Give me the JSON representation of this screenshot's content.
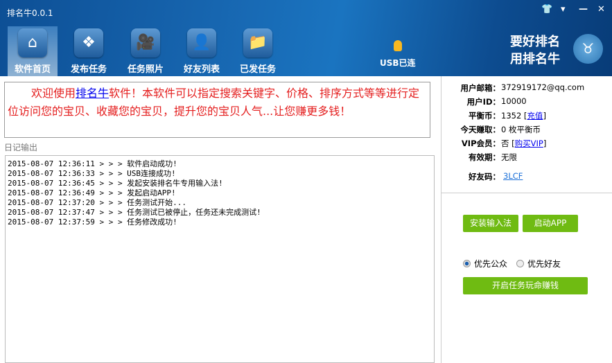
{
  "window": {
    "title": "排名牛0.0.1",
    "controls": [
      {
        "name": "skin",
        "glyph": "👕"
      },
      {
        "name": "menu",
        "glyph": "▾"
      },
      {
        "name": "minimize",
        "glyph": "—"
      },
      {
        "name": "close",
        "glyph": "✕"
      }
    ]
  },
  "nav": [
    {
      "label": "软件首页",
      "icon": "home-icon",
      "glyph": "⌂",
      "active": true
    },
    {
      "label": "发布任务",
      "icon": "diamond-grid-icon",
      "glyph": "❖"
    },
    {
      "label": "任务照片",
      "icon": "video-camera-icon",
      "glyph": "🎥"
    },
    {
      "label": "好友列表",
      "icon": "person-icon",
      "glyph": "👤"
    },
    {
      "label": "已发任务",
      "icon": "folder-icon",
      "glyph": "📁"
    }
  ],
  "usb_status": "USB已连",
  "slogan": {
    "line1": "要好排名",
    "line2": "用排名牛"
  },
  "welcome": {
    "pre": "欢迎使用",
    "link": "排名牛",
    "post": "软件！本软件可以指定搜索关键字、价格、排序方式等等进行定位访问您的宝贝、收藏您的宝贝，提升您的宝贝人气...让您赚更多钱！"
  },
  "log": {
    "label": "日记输出",
    "entries": [
      "2015-08-07 12:36:11 > > > 软件启动成功!",
      "2015-08-07 12:36:33 > > > USB连接成功!",
      "2015-08-07 12:36:45 > > > 发起安装排名牛专用输入法!",
      "2015-08-07 12:36:49 > > > 发起启动APP!",
      "2015-08-07 12:37:20 > > > 任务测试开始...",
      "2015-08-07 12:37:47 > > > 任务测试已被停止，任务还未完成测试!",
      "2015-08-07 12:37:59 > > > 任务修改成功!"
    ]
  },
  "user": {
    "email_label": "用户邮箱：",
    "email": "372919172@qq.com",
    "id_label": "用户ID：",
    "id": "10000",
    "balance_label": "平衡币：",
    "balance": "1352",
    "recharge": "充值",
    "today_label": "今天赚取：",
    "today": "0 枚平衡币",
    "vip_label": "VIP会员：",
    "vip": "否",
    "buy_vip": "购买VIP",
    "expiry_label": "有效期：",
    "expiry": "无限",
    "friend_code_label": "好友码：",
    "friend_code": "3LCF"
  },
  "actions": {
    "install_ime": "安装输入法",
    "launch_app": "启动APP",
    "priority_public": "优先公众",
    "priority_friend": "优先好友",
    "selected_priority": "优先公众",
    "start": "开启任务玩命赚钱"
  },
  "colors": {
    "header": "#1766b0",
    "button_green": "#6fbb12",
    "welcome_text": "#e41e1e"
  }
}
